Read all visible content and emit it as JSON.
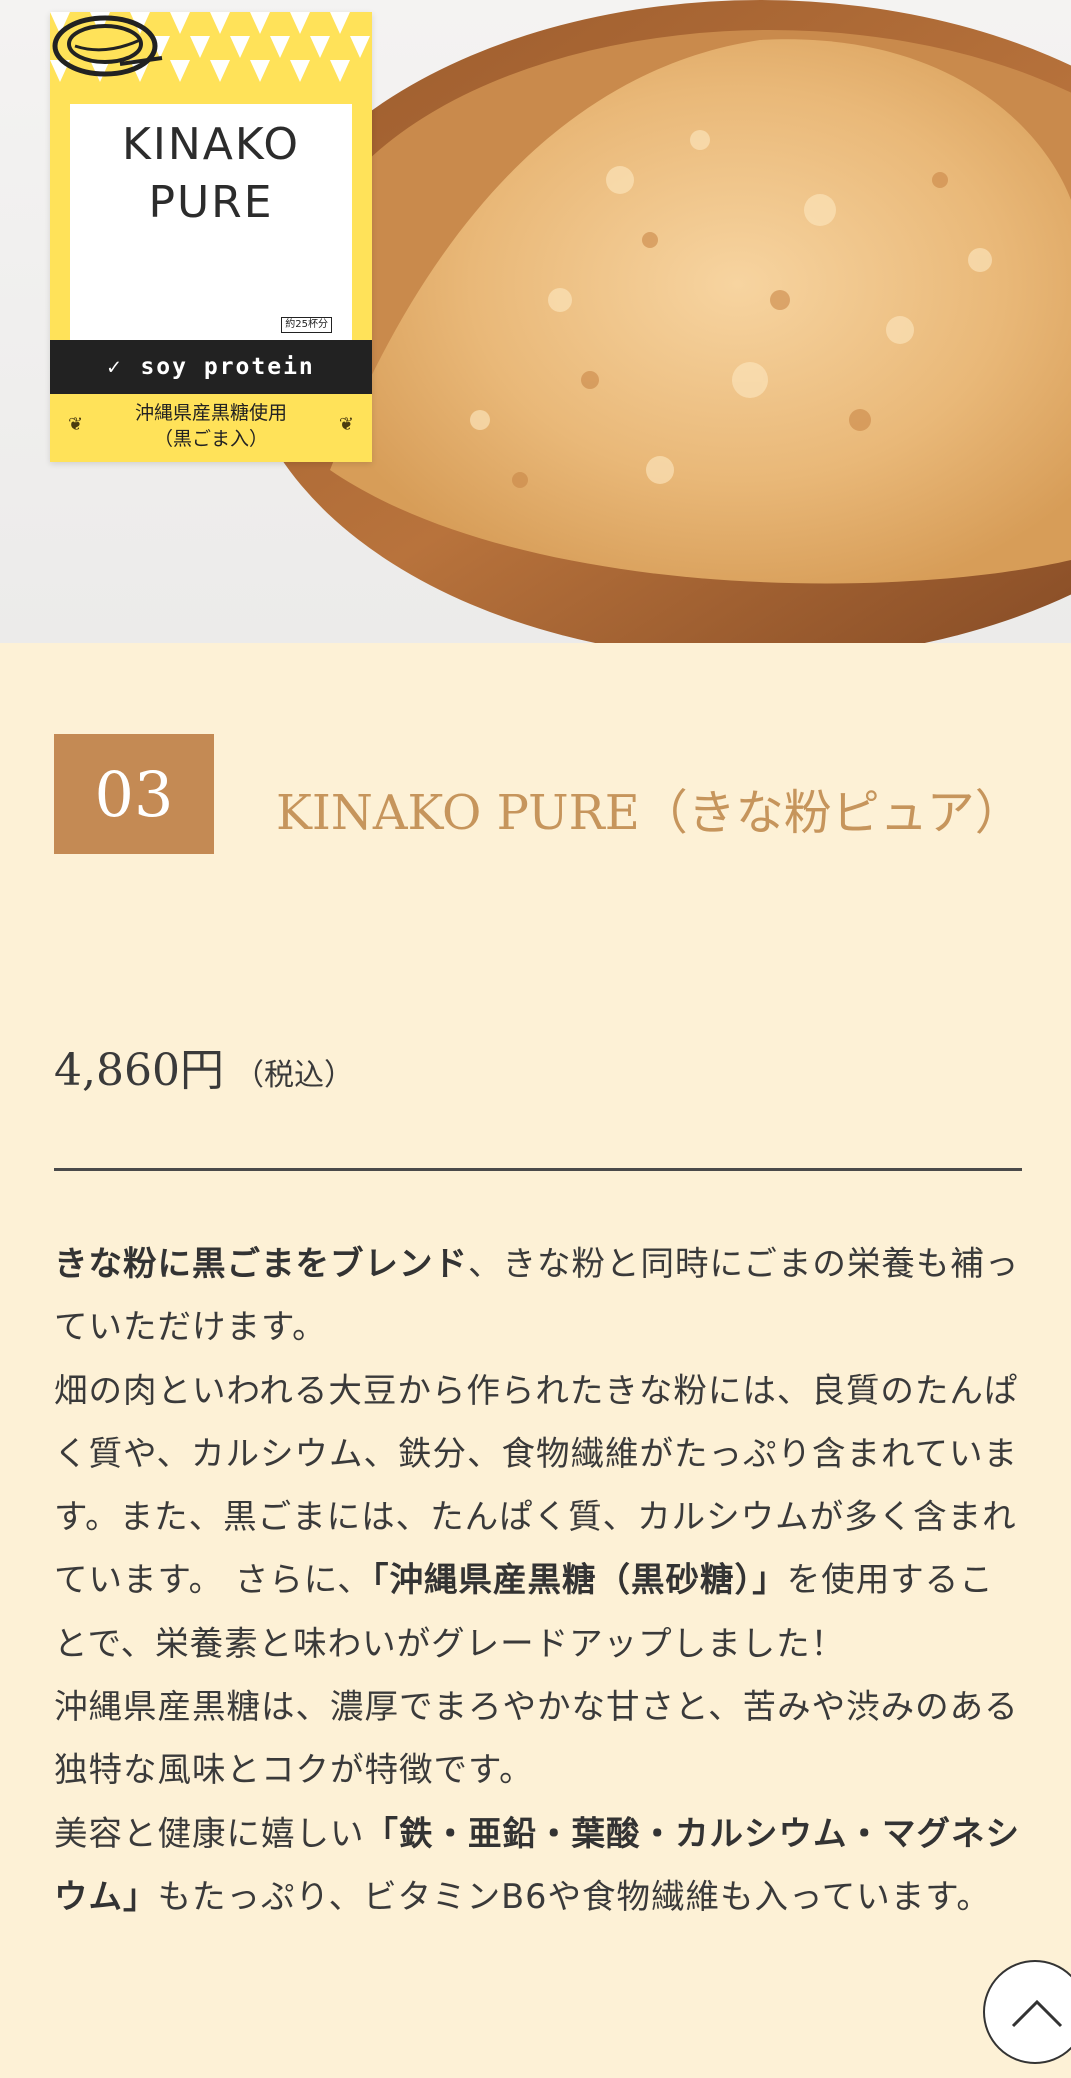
{
  "package": {
    "line1": "KINAKO",
    "line2": "PURE",
    "servings": "約25杯分",
    "band": "soy protein",
    "foot1": "沖縄県産黒糖使用",
    "foot2": "（黒ごま入）"
  },
  "product": {
    "number": "03",
    "title": "KINAKO PURE（きな粉ピュア）",
    "price": "4,860円",
    "tax_note": "（税込）"
  },
  "description": {
    "p1_bold": "きな粉に黒ごまをブレンド",
    "p1_rest": "、きな粉と同時にごまの栄養も補っていただけます。",
    "p2_a": "畑の肉といわれる大豆から作られたきな粉には、良質のたんぱく質や、カルシウム、鉄分、食物繊維がたっぷり含まれています。また、黒ごまには、たんぱく質、カルシウムが多く含まれています。 さらに、",
    "p2_bold": "「沖縄県産黒糖（黒砂糖）」",
    "p2_b": "を使用することで、栄養素と味わいがグレードアップしました！",
    "p3": "沖縄県産黒糖は、濃厚でまろやかな甘さと、苦みや渋みのある独特な風味とコクが特徴です。",
    "p4_a": "美容と健康に嬉しい",
    "p4_bold": "「鉄・亜鉛・葉酸・カルシウム・マグネシウム」",
    "p4_b": "もたっぷり、ビタミンB6や食物繊維も入っています。"
  },
  "colors": {
    "page_bg": "#fdf1d6",
    "accent": "#c48a54",
    "title": "#c6955c"
  },
  "icons": {
    "back_to_top": "chevron-up-icon"
  }
}
